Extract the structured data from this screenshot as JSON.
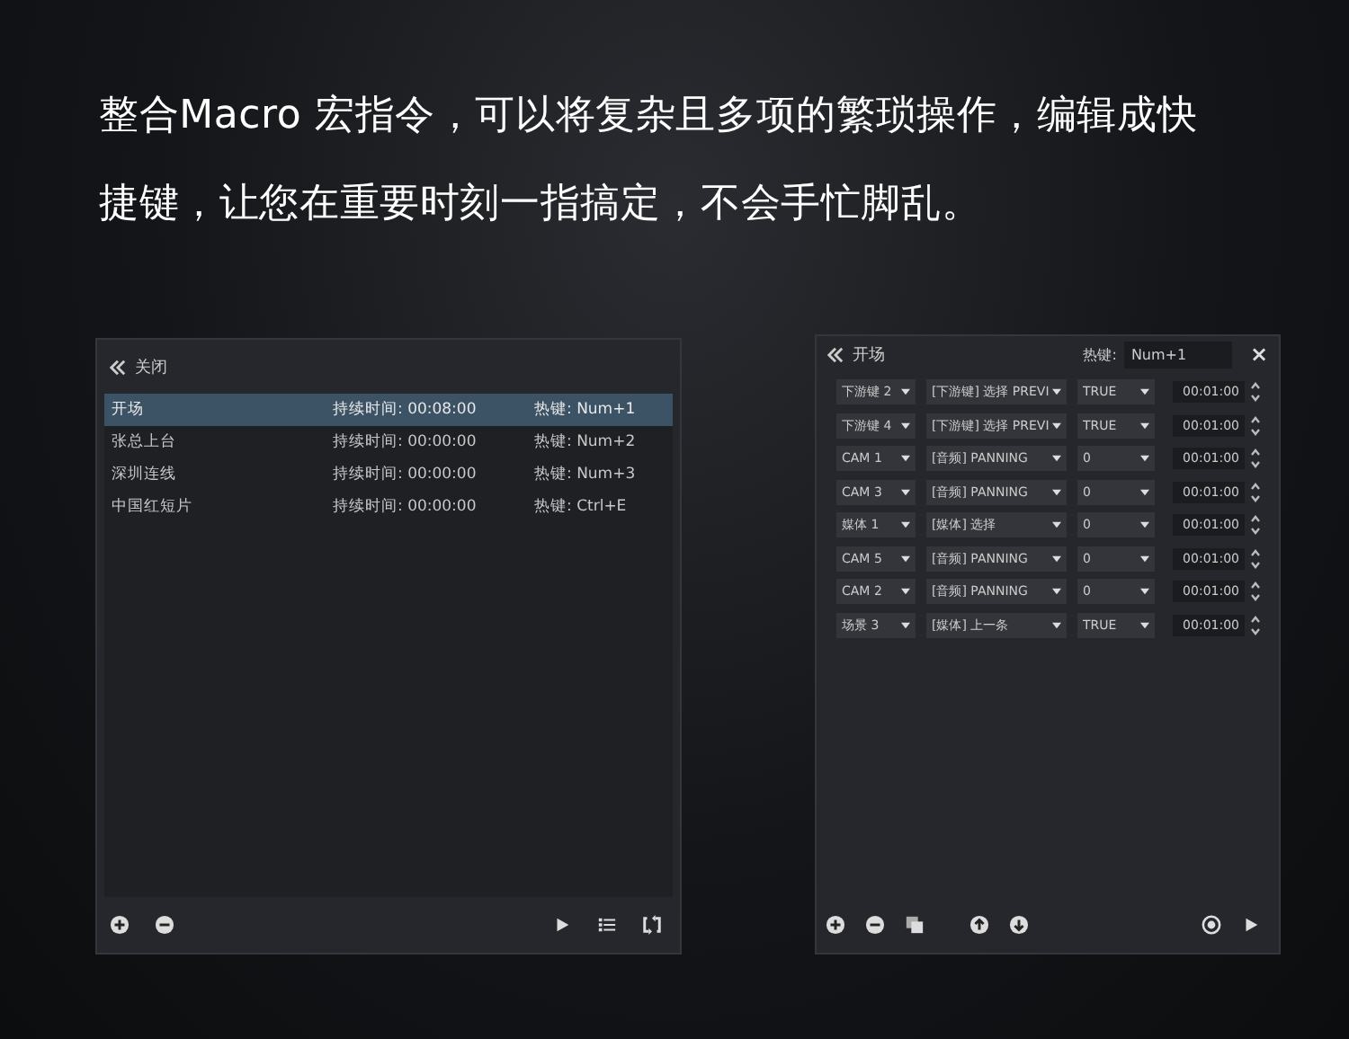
{
  "headline": [
    "整合Macro 宏指令，可以将复杂且多项的繁琐操作，编辑成快",
    "捷键，让您在重要时刻一指搞定，不会手忙脚乱。"
  ],
  "macro_list": {
    "back_label": "关闭",
    "items": [
      {
        "name": "开场",
        "duration": "持续时间: 00:08:00",
        "hotkey": "热键: Num+1",
        "selected": true
      },
      {
        "name": "张总上台",
        "duration": "持续时间: 00:00:00",
        "hotkey": "热键: Num+2",
        "selected": false
      },
      {
        "name": "深圳连线",
        "duration": "持续时间: 00:00:00",
        "hotkey": "热键: Num+3",
        "selected": false
      },
      {
        "name": "中国红短片",
        "duration": "持续时间: 00:00:00",
        "hotkey": "热键: Ctrl+E",
        "selected": false
      }
    ]
  },
  "macro_editor": {
    "back_label": "开场",
    "hotkey_label": "热键:",
    "hotkey_value": "Num+1",
    "close": "×",
    "steps": [
      {
        "source": "下游键 2",
        "action": "[下游键] 选择 PREVI",
        "value": "TRUE",
        "time": "00:01:00"
      },
      {
        "source": "下游键 4",
        "action": "[下游键] 选择 PREVI",
        "value": "TRUE",
        "time": "00:01:00"
      },
      {
        "source": "CAM 1",
        "action": "[音频] PANNING",
        "value": "0",
        "time": "00:01:00"
      },
      {
        "source": "CAM 3",
        "action": "[音频] PANNING",
        "value": "0",
        "time": "00:01:00"
      },
      {
        "source": "媒体 1",
        "action": "[媒体] 选择",
        "value": "0",
        "time": "00:01:00"
      },
      {
        "source": "CAM 5",
        "action": "[音频] PANNING",
        "value": "0",
        "time": "00:01:00"
      },
      {
        "source": "CAM 2",
        "action": "[音频] PANNING",
        "value": "0",
        "time": "00:01:00"
      },
      {
        "source": "场景 3",
        "action": "[媒体] 上一条",
        "value": "TRUE",
        "time": "00:01:00"
      }
    ]
  }
}
